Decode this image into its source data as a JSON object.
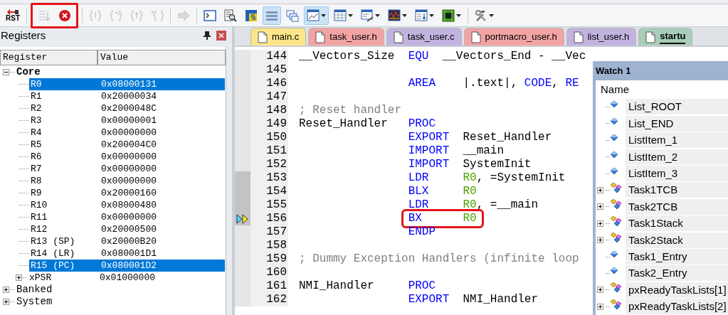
{
  "toolbar": {
    "groups": [
      {
        "items": [
          {
            "kind": "reset",
            "label": "RST",
            "disabled": false,
            "pressed": false,
            "dropdown": false
          }
        ]
      },
      {
        "highlighted": true,
        "items": [
          {
            "kind": "step-lines",
            "disabled": true,
            "pressed": false,
            "dropdown": false
          },
          {
            "kind": "stop",
            "disabled": false,
            "pressed": false,
            "dropdown": false
          }
        ]
      },
      {
        "items": [
          {
            "kind": "braces-in",
            "disabled": true,
            "pressed": false,
            "dropdown": false
          },
          {
            "kind": "braces-over",
            "disabled": true,
            "pressed": false,
            "dropdown": false
          },
          {
            "kind": "braces-out",
            "disabled": true,
            "pressed": false,
            "dropdown": false
          },
          {
            "kind": "braces-cursor",
            "disabled": true,
            "pressed": false,
            "dropdown": false
          }
        ]
      },
      {
        "items": [
          {
            "kind": "arrow",
            "disabled": true,
            "pressed": false,
            "dropdown": false
          }
        ]
      },
      {
        "items": [
          {
            "kind": "console",
            "disabled": false,
            "pressed": false,
            "dropdown": false
          },
          {
            "kind": "magnifier",
            "disabled": false,
            "pressed": false,
            "dropdown": false
          },
          {
            "kind": "symbols",
            "disabled": false,
            "pressed": false,
            "dropdown": false
          },
          {
            "kind": "rows",
            "disabled": false,
            "pressed": true,
            "dropdown": false
          },
          {
            "kind": "windows",
            "disabled": false,
            "pressed": false,
            "dropdown": false
          },
          {
            "kind": "chart",
            "disabled": false,
            "pressed": true,
            "dropdown": true
          },
          {
            "kind": "grid",
            "disabled": false,
            "pressed": false,
            "dropdown": true
          },
          {
            "kind": "pen",
            "disabled": false,
            "pressed": false,
            "dropdown": true
          },
          {
            "kind": "wave",
            "disabled": false,
            "pressed": false,
            "dropdown": true
          },
          {
            "kind": "list-arrow",
            "disabled": false,
            "pressed": false,
            "dropdown": true
          },
          {
            "kind": "chip",
            "disabled": false,
            "pressed": false,
            "dropdown": true
          }
        ]
      },
      {
        "items": [
          {
            "kind": "tools",
            "disabled": false,
            "pressed": false,
            "dropdown": true
          }
        ]
      }
    ]
  },
  "registers": {
    "title": "Registers",
    "columns": [
      "Register",
      "Value"
    ],
    "tree": [
      {
        "name": "Core",
        "expanded": true,
        "children": [
          {
            "name": "R0",
            "value": "0x08000131",
            "selected": true
          },
          {
            "name": "R1",
            "value": "0x20000034",
            "selected": false
          },
          {
            "name": "R2",
            "value": "0x2000048C",
            "selected": false
          },
          {
            "name": "R3",
            "value": "0x00000001",
            "selected": false
          },
          {
            "name": "R4",
            "value": "0x00000000",
            "selected": false
          },
          {
            "name": "R5",
            "value": "0x200004C0",
            "selected": false
          },
          {
            "name": "R6",
            "value": "0x00000000",
            "selected": false
          },
          {
            "name": "R7",
            "value": "0x00000000",
            "selected": false
          },
          {
            "name": "R8",
            "value": "0x00000000",
            "selected": false
          },
          {
            "name": "R9",
            "value": "0x20000160",
            "selected": false
          },
          {
            "name": "R10",
            "value": "0x08000480",
            "selected": false
          },
          {
            "name": "R11",
            "value": "0x00000000",
            "selected": false
          },
          {
            "name": "R12",
            "value": "0x20000500",
            "selected": false
          },
          {
            "name": "R13 (SP)",
            "value": "0x20000B20",
            "selected": false
          },
          {
            "name": "R14 (LR)",
            "value": "0x080001D1",
            "selected": false
          },
          {
            "name": "R15 (PC)",
            "value": "0x080001D2",
            "selected": true
          },
          {
            "name": "xPSR",
            "value": "0x01000000",
            "selected": false,
            "expanded": false
          }
        ]
      },
      {
        "name": "Banked",
        "expanded": false
      },
      {
        "name": "System",
        "expanded": false
      }
    ]
  },
  "editor": {
    "tabs": [
      {
        "label": "main.c",
        "color": "#fde68a",
        "selected": false
      },
      {
        "label": "task_user.h",
        "color": "#f2a3a3",
        "selected": false
      },
      {
        "label": "task_user.c",
        "color": "#c2b3e0",
        "selected": false
      },
      {
        "label": "portmacro_user.h",
        "color": "#f2a3a3",
        "selected": false
      },
      {
        "label": "list_user.h",
        "color": "#c2b3e0",
        "selected": false
      },
      {
        "label": "startu",
        "color": "#a8cdb8",
        "selected": true
      }
    ],
    "lines": [
      {
        "number": "144",
        "executed": false,
        "current": false,
        "label": "__Vectors_Size",
        "op": "EQU",
        "args": [
          {
            "text": "__Vectors_End - __Vec",
            "kind": "plain"
          }
        ]
      },
      {
        "number": "145",
        "executed": false,
        "current": false
      },
      {
        "number": "146",
        "executed": false,
        "current": false,
        "op": "AREA",
        "args": [
          {
            "text": "|.text|, ",
            "kind": "plain"
          },
          {
            "text": "CODE",
            "kind": "keyword"
          },
          {
            "text": ", ",
            "kind": "plain"
          },
          {
            "text": "RE",
            "kind": "keyword"
          }
        ]
      },
      {
        "number": "147",
        "executed": false,
        "current": false
      },
      {
        "number": "148",
        "executed": false,
        "current": false,
        "comment": "; Reset handler"
      },
      {
        "number": "149",
        "executed": false,
        "current": false,
        "label": "Reset_Handler",
        "op": "PROC"
      },
      {
        "number": "150",
        "executed": false,
        "current": false,
        "op": "EXPORT",
        "args": [
          {
            "text": "Reset_Handler",
            "kind": "plain"
          }
        ]
      },
      {
        "number": "151",
        "executed": false,
        "current": false,
        "op": "IMPORT",
        "args": [
          {
            "text": "__main",
            "kind": "plain"
          }
        ]
      },
      {
        "number": "152",
        "executed": false,
        "current": false,
        "op": "IMPORT",
        "args": [
          {
            "text": "SystemInit",
            "kind": "plain"
          }
        ]
      },
      {
        "number": "153",
        "executed": true,
        "current": false,
        "op": "LDR",
        "args": [
          {
            "text": "R0",
            "kind": "register"
          },
          {
            "text": ", =SystemInit",
            "kind": "plain"
          }
        ]
      },
      {
        "number": "154",
        "executed": true,
        "current": false,
        "op": "BLX",
        "args": [
          {
            "text": "R0",
            "kind": "register"
          }
        ]
      },
      {
        "number": "155",
        "executed": true,
        "current": false,
        "op": "LDR",
        "args": [
          {
            "text": "R0",
            "kind": "register"
          },
          {
            "text": ", =__main",
            "kind": "plain"
          }
        ]
      },
      {
        "number": "156",
        "executed": true,
        "current": true,
        "boxed": true,
        "op": "BX",
        "args": [
          {
            "text": "R0",
            "kind": "register"
          }
        ]
      },
      {
        "number": "157",
        "executed": false,
        "current": false,
        "op": "ENDP"
      },
      {
        "number": "158",
        "executed": false,
        "current": false
      },
      {
        "number": "159",
        "executed": false,
        "current": false,
        "comment": "; Dummy Exception Handlers (infinite loop"
      },
      {
        "number": "160",
        "executed": false,
        "current": false
      },
      {
        "number": "161",
        "executed": false,
        "current": false,
        "label": "NMI_Handler",
        "op": "PROC"
      },
      {
        "number": "162",
        "executed": false,
        "current": false,
        "op": "EXPORT",
        "args": [
          {
            "text": "NMI_Handler",
            "kind": "plain"
          }
        ]
      }
    ]
  },
  "watch": {
    "title": "Watch 1",
    "column": "Name",
    "rows": [
      {
        "name": "List_ROOT",
        "kind": "variable"
      },
      {
        "name": "List_END",
        "kind": "variable"
      },
      {
        "name": "ListItem_1",
        "kind": "variable"
      },
      {
        "name": "ListItem_2",
        "kind": "variable"
      },
      {
        "name": "ListItem_3",
        "kind": "variable"
      },
      {
        "name": "Task1TCB",
        "kind": "struct",
        "expanded": false
      },
      {
        "name": "Task2TCB",
        "kind": "struct",
        "expanded": false
      },
      {
        "name": "Task1Stack",
        "kind": "struct",
        "expanded": false
      },
      {
        "name": "Task2Stack",
        "kind": "struct",
        "expanded": false
      },
      {
        "name": "Task1_Entry",
        "kind": "variable"
      },
      {
        "name": "Task2_Entry",
        "kind": "variable"
      },
      {
        "name": "pxReadyTaskLists[1]",
        "kind": "struct",
        "expanded": false
      },
      {
        "name": "pxReadyTaskLists[2]",
        "kind": "struct",
        "expanded": false
      }
    ]
  }
}
